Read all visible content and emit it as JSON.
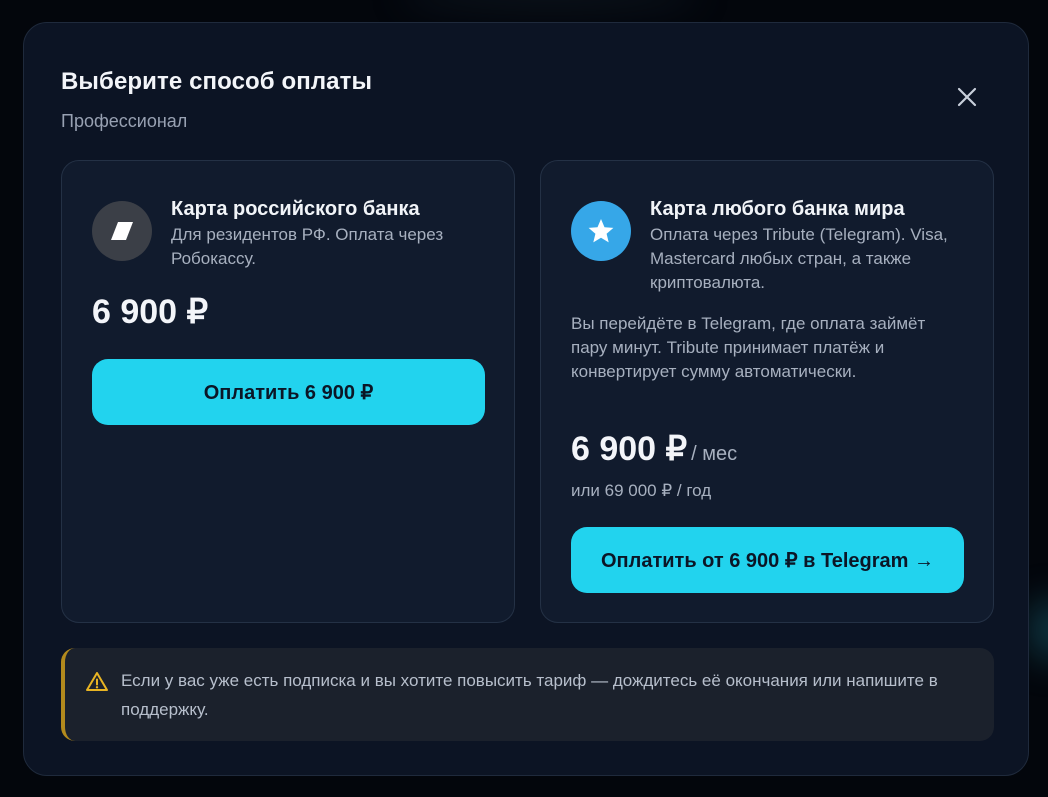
{
  "modal": {
    "title": "Выберите способ оплаты",
    "subtitle": "Профессионал",
    "close_icon": "close-icon"
  },
  "cards": {
    "russian_bank": {
      "icon": "card-icon",
      "title": "Карта российского банка",
      "description": "Для резидентов РФ. Оплата через Робокассу.",
      "price": "6 900 ₽",
      "button_label": "Оплатить 6 900 ₽"
    },
    "world_bank": {
      "icon": "star-icon",
      "title": "Карта любого банка мира",
      "description": "Оплата через Tribute (Telegram). Visa, Mastercard любых стран, а также криптовалюта.",
      "note": "Вы перейдёте в Telegram, где оплата займёт пару минут. Tribute принимает платёж и конвертирует сумму автоматически.",
      "price": "6 900 ₽",
      "price_unit": "/ мес",
      "alt_price": "или 69 000 ₽ / год",
      "button_label": "Оплатить от 6 900 ₽ в Telegram →"
    }
  },
  "notice": {
    "icon": "warning-icon",
    "text": "Если у вас уже есть подписка и вы хотите повысить тариф — дождитесь её окончания или напишите в поддержку."
  },
  "colors": {
    "accent": "#22d3ee",
    "modal_bg": "#0c1424",
    "card_bg": "#111b2d",
    "warning": "#e8b423",
    "telegram_blue": "#36a7e8"
  }
}
